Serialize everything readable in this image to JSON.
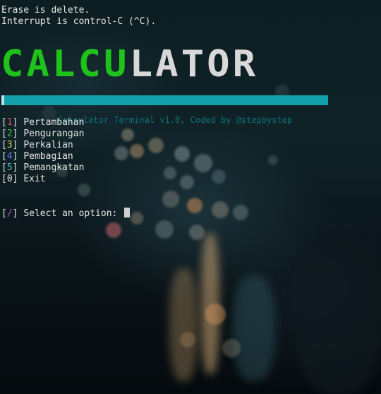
{
  "terminal": {
    "hint_erase": "Erase is delete.",
    "hint_interrupt": "Interrupt is control-C (^C)."
  },
  "banner": {
    "green_part": "CALCU",
    "white_part": "LATOR"
  },
  "title_bar": {
    "text": "Calculator Terminal v1.0, Coded by @stepbystep"
  },
  "menu": {
    "items": [
      {
        "number": "1",
        "label": "Pertambahan"
      },
      {
        "number": "2",
        "label": "Pengurangan"
      },
      {
        "number": "3",
        "label": "Perkalian"
      },
      {
        "number": "4",
        "label": "Pembagian"
      },
      {
        "number": "5",
        "label": "Pemangkatan"
      },
      {
        "number": "0",
        "label": "Exit"
      }
    ]
  },
  "prompt": {
    "symbol": "/",
    "text": "Select an option:",
    "value": ""
  },
  "colors": {
    "banner_green": "#1fc21a",
    "title_bar": "#11a0aa",
    "num_1": "#e14b4b",
    "num_2": "#38c038",
    "num_3": "#d9c64a",
    "num_4": "#5a78e8",
    "num_5": "#45b8c8",
    "prompt_symbol": "#b44ad0"
  }
}
